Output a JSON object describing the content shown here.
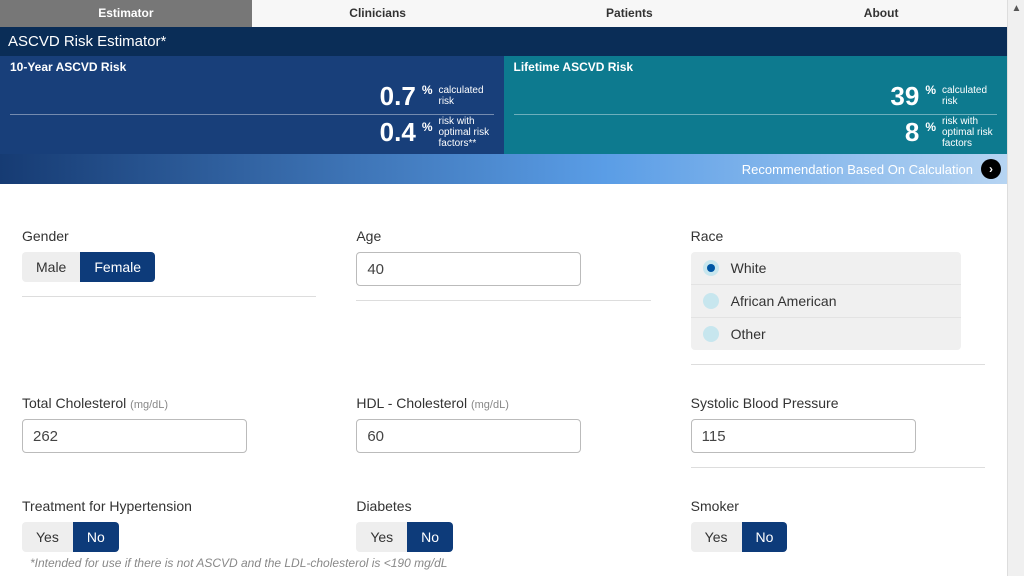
{
  "tabs": {
    "estimator": "Estimator",
    "clinicians": "Clinicians",
    "patients": "Patients",
    "about": "About"
  },
  "title": "ASCVD Risk Estimator*",
  "ten_year": {
    "heading": "10-Year ASCVD Risk",
    "calc_value": "0.7",
    "calc_pct": "%",
    "calc_label": "calculated risk",
    "opt_value": "0.4",
    "opt_pct": "%",
    "opt_label": "risk with optimal risk factors**"
  },
  "lifetime": {
    "heading": "Lifetime ASCVD Risk",
    "calc_value": "39",
    "calc_pct": "%",
    "calc_label": "calculated risk",
    "opt_value": "8",
    "opt_pct": "%",
    "opt_label": "risk with optimal risk factors"
  },
  "reco": {
    "text": "Recommendation Based On Calculation",
    "arrow": "›"
  },
  "form": {
    "gender": {
      "label": "Gender",
      "male": "Male",
      "female": "Female",
      "selected": "female"
    },
    "age": {
      "label": "Age",
      "value": "40"
    },
    "race": {
      "label": "Race",
      "white": "White",
      "aa": "African American",
      "other": "Other",
      "selected": "white"
    },
    "tc": {
      "label": "Total Cholesterol ",
      "unit": "(mg/dL)",
      "value": "262"
    },
    "hdl": {
      "label": "HDL - Cholesterol ",
      "unit": "(mg/dL)",
      "value": "60"
    },
    "sbp": {
      "label": "Systolic Blood Pressure",
      "value": "115"
    },
    "htn": {
      "label": "Treatment for Hypertension",
      "yes": "Yes",
      "no": "No",
      "selected": "no"
    },
    "dm": {
      "label": "Diabetes",
      "yes": "Yes",
      "no": "No",
      "selected": "no"
    },
    "smoker": {
      "label": "Smoker",
      "yes": "Yes",
      "no": "No",
      "selected": "no"
    }
  },
  "footnote": "*Intended for use if there is not ASCVD and the LDL-cholesterol is <190 mg/dL"
}
